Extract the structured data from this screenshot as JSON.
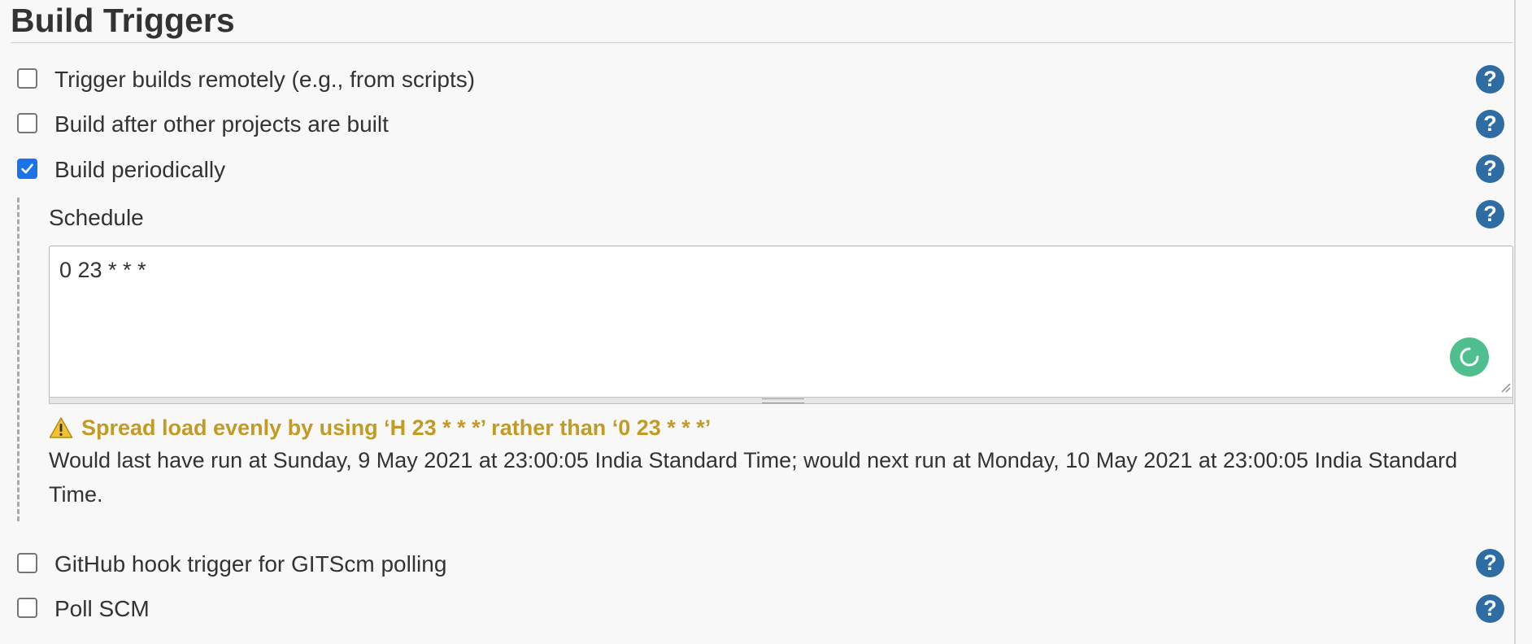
{
  "section": {
    "title": "Build Triggers"
  },
  "triggers": [
    {
      "label": "Trigger builds remotely (e.g., from scripts)",
      "checked": false
    },
    {
      "label": "Build after other projects are built",
      "checked": false
    },
    {
      "label": "Build periodically",
      "checked": true
    },
    {
      "label": "GitHub hook trigger for GITScm polling",
      "checked": false
    },
    {
      "label": "Poll SCM",
      "checked": false
    }
  ],
  "schedule": {
    "label": "Schedule",
    "value": "0 23 * * *",
    "warning": "Spread load evenly by using ‘H 23 * * *’ rather than ‘0 23 * * *’",
    "info": "Would last have run at Sunday, 9 May 2021 at 23:00:05 India Standard Time; would next run at Monday, 10 May 2021 at 23:00:05 India Standard Time."
  },
  "help": {
    "glyph": "?"
  },
  "icons": {
    "help": "help-icon",
    "warning": "warning-icon",
    "loading": "loading-spinner-icon",
    "checkmark": "checkmark-icon"
  },
  "colors": {
    "help_icon": "#2e6ca4",
    "checkbox_checked": "#1a73e8",
    "warning_text": "#c29b24",
    "spinner": "#4fbf8f",
    "background": "#f8f8f8"
  }
}
